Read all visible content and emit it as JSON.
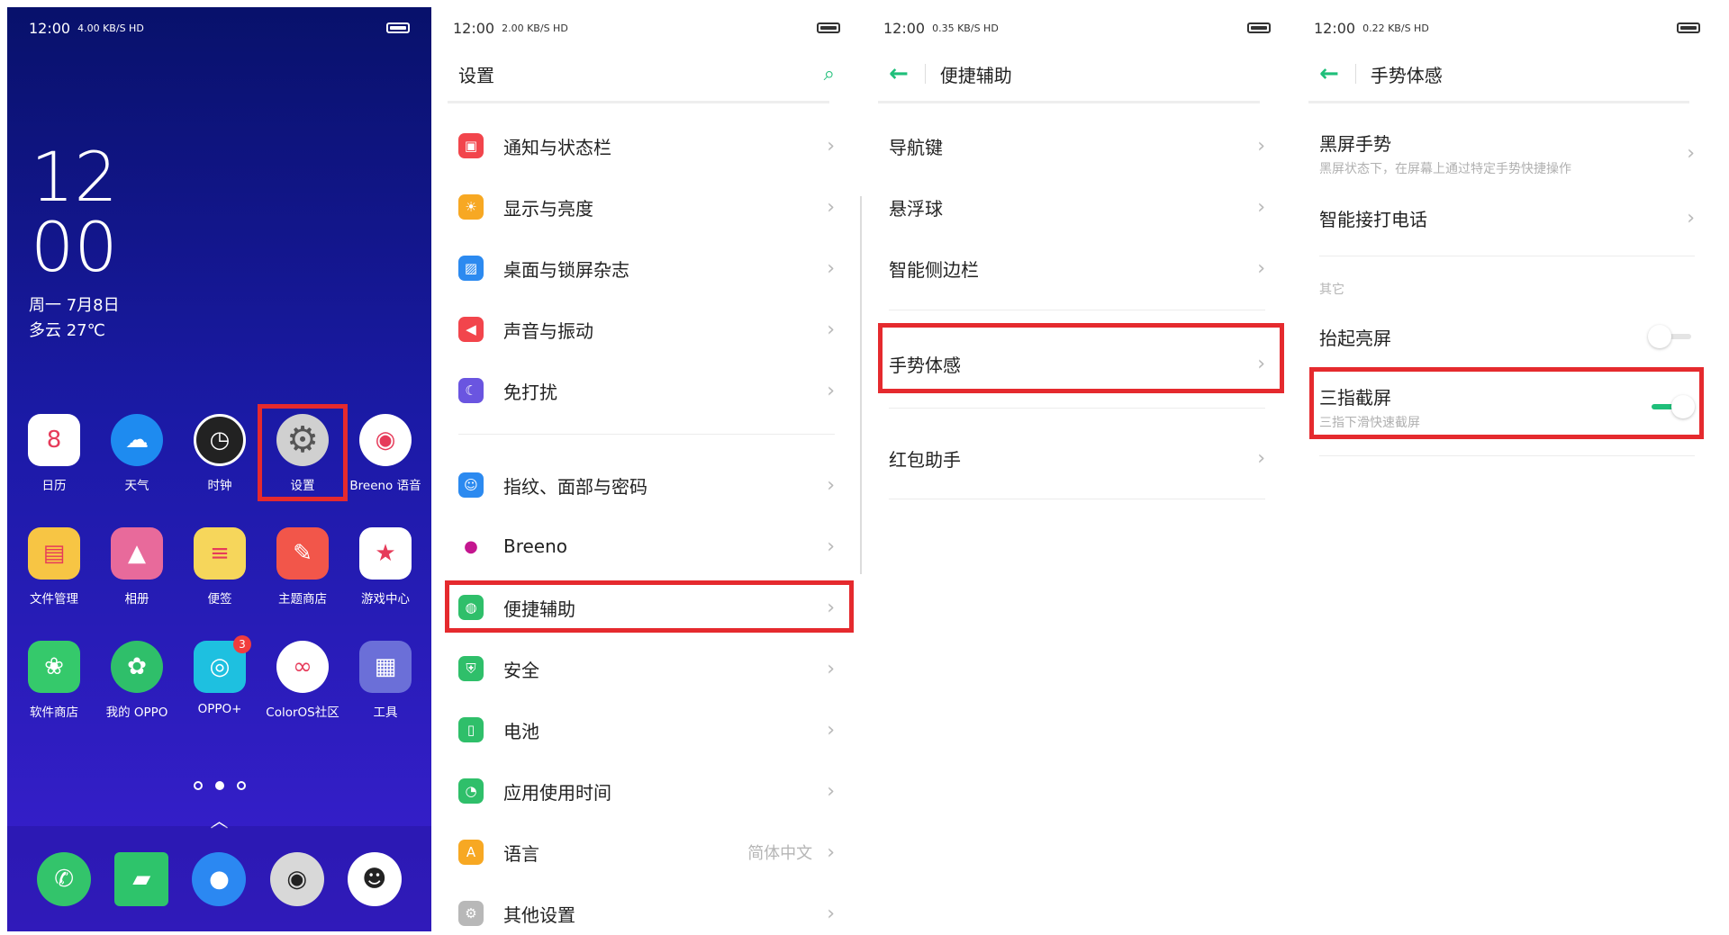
{
  "colors": {
    "accent": "#1fbf7a",
    "highlight": "#e52a2e"
  },
  "home": {
    "status": {
      "time": "12:00",
      "net": "4.00 KB/S HD"
    },
    "clock": {
      "hour": "12",
      "minute": "00"
    },
    "date": "周一 7月8日",
    "weather": "多云 27℃",
    "apps_row1": [
      {
        "label": "日历",
        "icon": "calendar-icon",
        "glyph": "8",
        "color": "#ffffff"
      },
      {
        "label": "天气",
        "icon": "weather-icon",
        "glyph": "☁",
        "color": "#1e8bf0"
      },
      {
        "label": "时钟",
        "icon": "clock-icon",
        "glyph": "◷",
        "color": "#222222"
      },
      {
        "label": "设置",
        "icon": "gear-icon",
        "glyph": "⚙",
        "color": "#d0d0d0"
      },
      {
        "label": "Breeno 语音",
        "icon": "breeno-voice-icon",
        "glyph": "◉",
        "color": "#ffffff"
      }
    ],
    "apps_row2": [
      {
        "label": "文件管理",
        "icon": "folder-icon",
        "glyph": "▤",
        "color": "#f7c544"
      },
      {
        "label": "相册",
        "icon": "gallery-icon",
        "glyph": "▲",
        "color": "#e86a9b"
      },
      {
        "label": "便签",
        "icon": "notes-icon",
        "glyph": "≡",
        "color": "#f6d65b"
      },
      {
        "label": "主题商店",
        "icon": "theme-store-icon",
        "glyph": "✎",
        "color": "#f2564a"
      },
      {
        "label": "游戏中心",
        "icon": "game-center-icon",
        "glyph": "★",
        "color": "#ffffff"
      }
    ],
    "apps_row3": [
      {
        "label": "软件商店",
        "icon": "app-store-icon",
        "glyph": "❀",
        "color": "#35c96b"
      },
      {
        "label": "我的 OPPO",
        "icon": "my-oppo-icon",
        "glyph": "✿",
        "color": "#2fbf6a"
      },
      {
        "label": "OPPO+",
        "icon": "oppo-plus-icon",
        "glyph": "◎",
        "color": "#1ec0e0",
        "badge": "3"
      },
      {
        "label": "ColorOS社区",
        "icon": "coloros-community-icon",
        "glyph": "∞",
        "color": "#ffffff"
      },
      {
        "label": "工具",
        "icon": "tools-folder-icon",
        "glyph": "▦",
        "color": "#6b6fd8"
      }
    ],
    "dock": [
      {
        "icon": "phone-icon",
        "glyph": "✆",
        "color": "#33c46b"
      },
      {
        "icon": "messages-icon",
        "glyph": "▰",
        "color": "#2ec46b"
      },
      {
        "icon": "browser-icon",
        "glyph": "●",
        "color": "#2b88f2"
      },
      {
        "icon": "camera-icon",
        "glyph": "◉",
        "color": "#d8d8d8"
      },
      {
        "icon": "qq-icon",
        "glyph": "☻",
        "color": "#ffffff"
      }
    ]
  },
  "settings": {
    "status": {
      "time": "12:00",
      "net": "2.00 KB/S HD"
    },
    "title": "设置",
    "items": [
      {
        "label": "通知与状态栏",
        "icon": "notification-icon",
        "glyph": "▣",
        "color": "#f2454c"
      },
      {
        "label": "显示与亮度",
        "icon": "brightness-icon",
        "glyph": "☀",
        "color": "#f7a823"
      },
      {
        "label": "桌面与锁屏杂志",
        "icon": "wallpaper-icon",
        "glyph": "▨",
        "color": "#2c8af0"
      },
      {
        "label": "声音与振动",
        "icon": "sound-icon",
        "glyph": "◀",
        "color": "#f2454c"
      },
      {
        "label": "免打扰",
        "icon": "moon-icon",
        "glyph": "☾",
        "color": "#6a55e0"
      },
      {
        "label": "指纹、面部与密码",
        "icon": "fingerprint-icon",
        "glyph": "☺",
        "color": "#2c8af0"
      },
      {
        "label": "Breeno",
        "icon": "breeno-icon",
        "glyph": "●",
        "color": "#ffffff"
      },
      {
        "label": "便捷辅助",
        "icon": "convenience-icon",
        "glyph": "◍",
        "color": "#2fbf6a"
      },
      {
        "label": "安全",
        "icon": "shield-icon",
        "glyph": "⛨",
        "color": "#2fbf6a"
      },
      {
        "label": "电池",
        "icon": "battery-icon",
        "glyph": "▯",
        "color": "#2fbf6a"
      },
      {
        "label": "应用使用时间",
        "icon": "usage-time-icon",
        "glyph": "◔",
        "color": "#2fbf6a"
      },
      {
        "label": "语言",
        "icon": "language-icon",
        "glyph": "A",
        "color": "#f7a823",
        "value": "简体中文"
      },
      {
        "label": "其他设置",
        "icon": "other-settings-icon",
        "glyph": "⚙",
        "color": "#b8b8b8"
      }
    ]
  },
  "convenience": {
    "status": {
      "time": "12:00",
      "net": "0.35 KB/S HD"
    },
    "title": "便捷辅助",
    "items": [
      {
        "label": "导航键"
      },
      {
        "label": "悬浮球"
      },
      {
        "label": "智能侧边栏"
      },
      {
        "label": "手势体感"
      },
      {
        "label": "红包助手"
      }
    ]
  },
  "gestures": {
    "status": {
      "time": "12:00",
      "net": "0.22 KB/S HD"
    },
    "title": "手势体感",
    "screen_off": {
      "label": "黑屏手势",
      "sub": "黑屏状态下，在屏幕上通过特定手势快捷操作"
    },
    "smart_call": {
      "label": "智能接打电话"
    },
    "section_other": "其它",
    "raise_wake": {
      "label": "抬起亮屏",
      "on": false
    },
    "three_finger": {
      "label": "三指截屏",
      "sub": "三指下滑快速截屏",
      "on": true
    }
  }
}
